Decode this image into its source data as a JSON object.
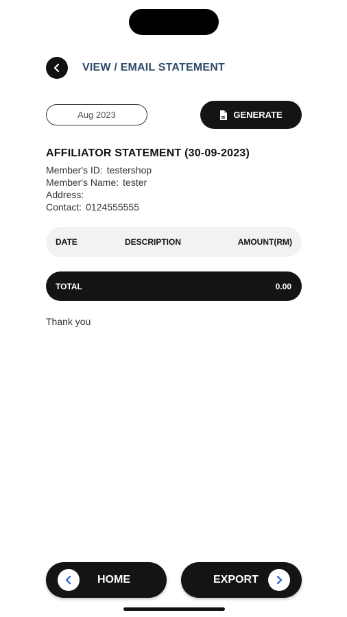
{
  "header": {
    "title": "VIEW / EMAIL STATEMENT",
    "back_icon": "chevron-left-icon"
  },
  "filters": {
    "month": "Aug 2023",
    "generate_label": "GENERATE",
    "generate_icon": "document-icon"
  },
  "statement": {
    "title": "AFFILIATOR STATEMENT (30-09-2023)",
    "member_id_label": "Member's ID:",
    "member_id": "testershop",
    "member_name_label": "Member's Name:",
    "member_name": "tester",
    "address_label": "Address:",
    "address": "",
    "contact_label": "Contact:",
    "contact": "0124555555"
  },
  "table": {
    "columns": [
      "DATE",
      "DESCRIPTION",
      "AMOUNT(RM)"
    ],
    "rows": [],
    "total_label": "TOTAL",
    "total_value": "0.00"
  },
  "footer_note": "Thank you",
  "nav": {
    "home_label": "HOME",
    "export_label": "EXPORT",
    "home_icon": "chevron-left-icon",
    "export_icon": "chevron-right-icon"
  },
  "colors": {
    "title": "#2e4a6b",
    "button_bg": "#141414",
    "chevron_accent": "#2f6fd6"
  }
}
